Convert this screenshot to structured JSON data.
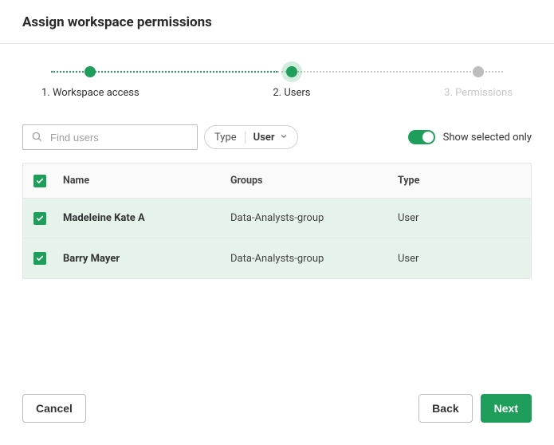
{
  "title": "Assign workspace permissions",
  "stepper": {
    "steps": [
      {
        "label": "1. Workspace access",
        "state": "done"
      },
      {
        "label": "2. Users",
        "state": "current"
      },
      {
        "label": "3. Permissions",
        "state": "pending"
      }
    ]
  },
  "search": {
    "placeholder": "Find users"
  },
  "type_filter": {
    "label": "Type",
    "value": "User"
  },
  "toggle": {
    "label": "Show selected only",
    "checked": true
  },
  "table": {
    "headers": {
      "name": "Name",
      "groups": "Groups",
      "type": "Type"
    },
    "rows": [
      {
        "selected": true,
        "name": "Madeleine Kate A",
        "groups": "Data-Analysts-group",
        "type": "User"
      },
      {
        "selected": true,
        "name": "Barry Mayer",
        "groups": "Data-Analysts-group",
        "type": "User"
      }
    ]
  },
  "footer": {
    "cancel": "Cancel",
    "back": "Back",
    "next": "Next"
  }
}
